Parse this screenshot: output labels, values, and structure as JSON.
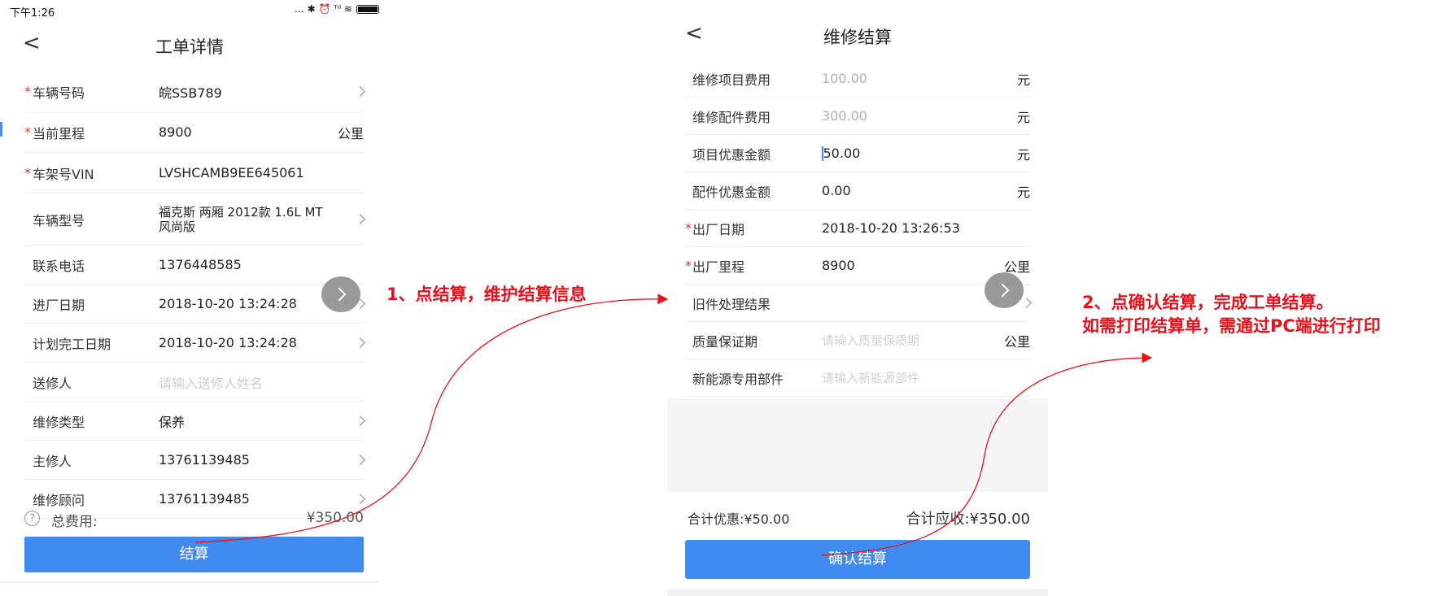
{
  "phone1": {
    "status_time": "下午1:26",
    "status_icons": "… ✱ ⏰ ᵀᴵˡ ≋",
    "back_glyph": "<",
    "title": "工单详情",
    "rows": [
      {
        "required": "*",
        "label": "车辆号码",
        "value": "皖SSB789",
        "chevron": true
      },
      {
        "required": "*",
        "label": "当前里程",
        "value": "8900",
        "unit": "公里"
      },
      {
        "required": "*",
        "label": "车架号VIN",
        "value": "LVSHCAMB9EE645061"
      },
      {
        "required": "",
        "label": "车辆型号",
        "value": "福克斯 两厢 2012款 1.6L MT",
        "value2": "风尚版",
        "chevron": true
      },
      {
        "required": "",
        "label": "联系电话",
        "value": "1376448585"
      },
      {
        "required": "",
        "label": "进厂日期",
        "value": "2018-10-20 13:24:28",
        "chevron": true
      },
      {
        "required": "",
        "label": "计划完工日期",
        "value": "2018-10-20 13:24:28",
        "chevron": true
      },
      {
        "required": "",
        "label": "送修人",
        "placeholder": "请输入送修人姓名"
      },
      {
        "required": "",
        "label": "维修类型",
        "value": "保养",
        "chevron": true
      },
      {
        "required": "",
        "label": "主修人",
        "value": "13761139485",
        "chevron": true
      },
      {
        "required": "",
        "label": "维修顾问",
        "value": "13761139485",
        "chevron": true
      }
    ],
    "total_icon": "?",
    "total_label": "总费用:",
    "total_value": "¥350.00",
    "settle_button": "结算"
  },
  "phone2": {
    "title": "维修结算",
    "back_glyph": "<",
    "rows": [
      {
        "required": "",
        "label": "维修项目费用",
        "value": "100.00",
        "muted": true,
        "unit": "元"
      },
      {
        "required": "",
        "label": "维修配件费用",
        "value": "300.00",
        "muted": true,
        "unit": "元"
      },
      {
        "required": "",
        "label": "项目优惠金额",
        "value": "50.00",
        "caret": true,
        "unit": "元"
      },
      {
        "required": "",
        "label": "配件优惠金额",
        "value": "0.00",
        "unit": "元"
      },
      {
        "required": "*",
        "label": "出厂日期",
        "value": "2018-10-20 13:26:53"
      },
      {
        "required": "*",
        "label": "出厂里程",
        "value": "8900",
        "unit": "公里"
      },
      {
        "required": "",
        "label": "旧件处理结果",
        "chevron": true
      },
      {
        "required": "",
        "label": "质量保证期",
        "placeholder": "请输入质量保质期",
        "unit": "公里"
      },
      {
        "required": "",
        "label": "新能源专用部件",
        "placeholder": "请输入新能源部件"
      }
    ],
    "discount_total": "合计优惠:¥50.00",
    "receivable_total": "合计应收:¥350.00",
    "confirm_button": "确认结算"
  },
  "annotations": {
    "step1": "1、点结算，维护结算信息",
    "step2_line1": "2、点确认结算，完成工单结算。",
    "step2_line2": "如需打印结算单，需通过PC端进行打印"
  },
  "colors": {
    "primary_button": "#3f8bf0",
    "required_star": "#e0302f",
    "annotation": "#e8101a"
  }
}
